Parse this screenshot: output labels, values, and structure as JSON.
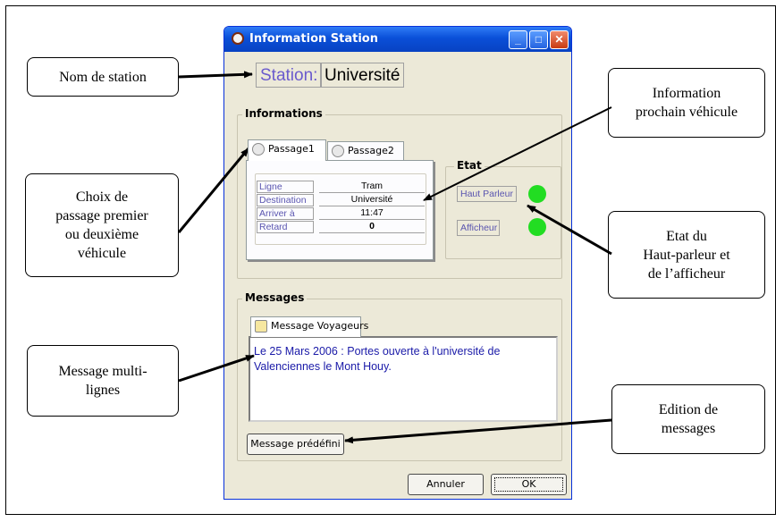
{
  "window": {
    "title": "Information Station",
    "controls": {
      "minimize": "_",
      "maximize": "□",
      "close": "✕"
    }
  },
  "station": {
    "label": "Station:",
    "value": "Université"
  },
  "informations": {
    "group_title": "Informations",
    "tabs": [
      {
        "label": "Passage1",
        "icon": "clock-icon",
        "active": true
      },
      {
        "label": "Passage2",
        "icon": "clock-icon",
        "active": false
      }
    ],
    "rows": [
      {
        "key": "Ligne",
        "value": "Tram"
      },
      {
        "key": "Destination",
        "value": "Université"
      },
      {
        "key": "Arriver à",
        "value": "11:47"
      },
      {
        "key": "Retard",
        "value": "0"
      }
    ],
    "etat": {
      "group_title": "Etat",
      "items": [
        {
          "label": "Haut Parleur",
          "status_color": "#22dd22"
        },
        {
          "label": "Afficheur",
          "status_color": "#22dd22"
        }
      ]
    }
  },
  "messages": {
    "group_title": "Messages",
    "tab_label": "Message Voyageurs",
    "text_line1": "Le 25 Mars 2006 : Portes ouverte à l'université de",
    "text_line2": "Valenciennes le Mont Houy.",
    "predefined_button": "Message prédéfini"
  },
  "footer": {
    "cancel": "Annuler",
    "ok": "OK"
  },
  "callouts": {
    "station_name": "Nom de station",
    "next_vehicle_1": "Information",
    "next_vehicle_2": "prochain véhicule",
    "choice_1": "Choix de",
    "choice_2": "passage premier",
    "choice_3": "ou deuxième",
    "choice_4": "véhicule",
    "state_1": "Etat du",
    "state_2": "Haut-parleur et",
    "state_3": "de l’afficheur",
    "multiline_1": "Message multi-",
    "multiline_2": "lignes",
    "edit_1": "Edition de",
    "edit_2": "messages"
  },
  "colors": {
    "title_bar": "#0a4fd8",
    "window_bg": "#ece9d8",
    "label_text": "#5a55b0",
    "message_text": "#1a1aa8"
  }
}
